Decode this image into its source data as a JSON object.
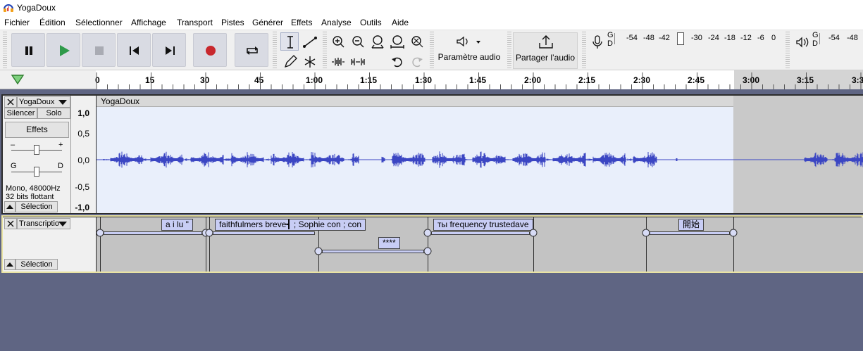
{
  "window": {
    "title": "YogaDoux"
  },
  "menu": [
    "Fichier",
    "Édition",
    "Sélectionner",
    "Affichage",
    "Transport",
    "Pistes",
    "Générer",
    "Effets",
    "Analyse",
    "Outils",
    "Aide"
  ],
  "toolbar": {
    "audio_setup_label": "Paramètre audio",
    "share_audio_label": "Partager l’audio",
    "meter_record_channels": [
      "G",
      "D"
    ],
    "meter_record_scale": [
      "-54",
      "-48",
      "-42",
      "-",
      "-30",
      "-24",
      "-18",
      "-12",
      "-6",
      "0"
    ],
    "meter_play_channels": [
      "G",
      "D"
    ],
    "meter_play_scale": [
      "-54",
      "-48"
    ]
  },
  "ruler": {
    "ticks": [
      "0",
      "15",
      "30",
      "45",
      "1:00",
      "1:15",
      "1:30",
      "1:45",
      "2:00",
      "2:15",
      "2:30",
      "2:45",
      "3:00",
      "3:15",
      "3:3"
    ]
  },
  "audio_track": {
    "name": "YogaDoux",
    "mute_label": "Silencer",
    "solo_label": "Solo",
    "effects_label": "Effets",
    "gain_minus": "–",
    "gain_plus": "+",
    "pan_left": "G",
    "pan_right": "D",
    "info_line1": "Mono, 48000Hz",
    "info_line2": "32 bits flottant",
    "select_label": "Sélection",
    "clip_title": "YogaDoux",
    "scale": [
      "1,0",
      "0,5",
      "0,0",
      "-0,5",
      "-1,0"
    ]
  },
  "label_track": {
    "name": "Transcriptio",
    "select_label": "Sélection",
    "labels": [
      "a i lu \"",
      "faithfulmers breve┫ ; Sophie con ; con",
      "****",
      "ты frequency trustedave",
      "開始"
    ]
  },
  "colors": {
    "waveform": "#3b46c3",
    "waveform_bg": "#e9effb",
    "label_fill": "#c8cdf4",
    "play_green": "#2e9a4a",
    "record_red": "#c8282d",
    "label_track_border": "#e9e3a3"
  }
}
